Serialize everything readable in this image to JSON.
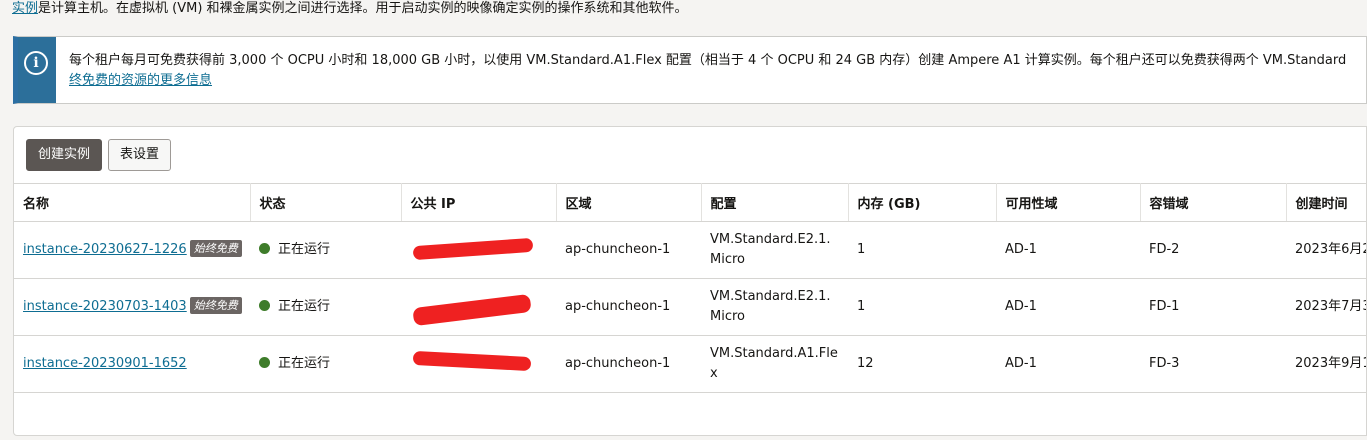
{
  "intro": {
    "link": "实例",
    "rest": "是计算主机。在虚拟机 (VM) 和裸金属实例之间进行选择。用于启动实例的映像确定实例的操作系统和其他软件。"
  },
  "notice": {
    "icon": "info-icon",
    "line1": "每个租户每月可免费获得前 3,000 个 OCPU 小时和 18,000 GB 小时，以使用 VM.Standard.A1.Flex 配置（相当于 4 个 OCPU 和 24 GB 内存）创建 Ampere A1 计算实例。每个租户还可以免费获得两个 VM.Standard",
    "link": "终免费的资源的更多信息"
  },
  "toolbar": {
    "create_label": "创建实例",
    "settings_label": "表设置"
  },
  "table": {
    "headers": [
      "名称",
      "状态",
      "公共 IP",
      "区域",
      "配置",
      "内存 (GB)",
      "可用性域",
      "容错域",
      "创建时间"
    ],
    "rows": [
      {
        "name": "instance-20230627-1226",
        "badge": "始终免费",
        "status": "正在运行",
        "region": "ap-chuncheon-1",
        "shape1": "VM.Standard.E2.1.",
        "shape2": "Micro",
        "memory": "1",
        "ad": "AD-1",
        "fd": "FD-2",
        "created": "2023年6月2"
      },
      {
        "name": "instance-20230703-1403",
        "badge": "始终免费",
        "status": "正在运行",
        "region": "ap-chuncheon-1",
        "shape1": "VM.Standard.E2.1.",
        "shape2": "Micro",
        "memory": "1",
        "ad": "AD-1",
        "fd": "FD-1",
        "created": "2023年7月3"
      },
      {
        "name": "instance-20230901-1652",
        "badge": "",
        "status": "正在运行",
        "region": "ap-chuncheon-1",
        "shape1": "VM.Standard.A1.Fle",
        "shape2": "x",
        "memory": "12",
        "ad": "AD-1",
        "fd": "FD-3",
        "created": "2023年9月1"
      }
    ]
  },
  "colors": {
    "link": "#0e6d92",
    "status_running": "#3e7c2a",
    "notice_accent": "#2c6f9a",
    "primary_button": "#5b5653",
    "redaction": "#ef2121"
  }
}
